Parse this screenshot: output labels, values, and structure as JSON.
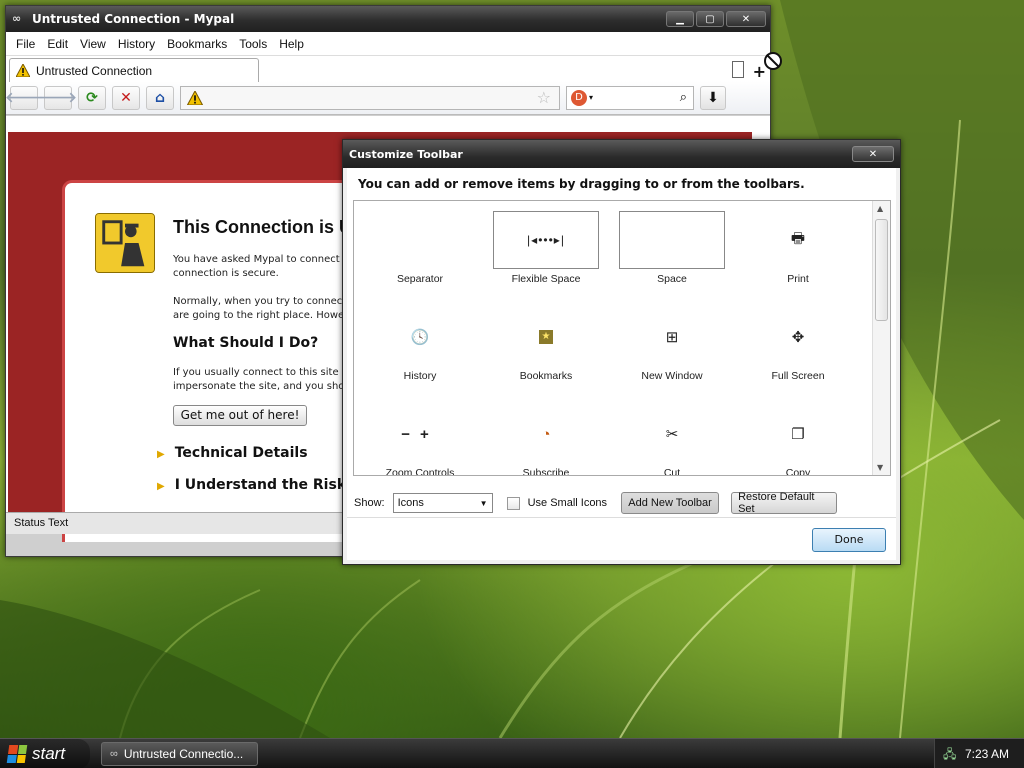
{
  "browser": {
    "title": "Untrusted Connection - Mypal",
    "menu": [
      "File",
      "Edit",
      "View",
      "History",
      "Bookmarks",
      "Tools",
      "Help"
    ],
    "tab_title": "Untrusted Connection",
    "new_tab": "+",
    "status_text": "Status Text"
  },
  "error_page": {
    "title": "This Connection is U",
    "p1_line1": "You have asked Mypal to connect se",
    "p1_line2": "connection is secure.",
    "p2_line1": "Normally, when you try to connect s",
    "p2_line2": "are going to the right place. Howev",
    "heading": "What Should I Do?",
    "p3_line1": "If you usually connect to this site wi",
    "p3_line2": "impersonate the site, and you shoul",
    "button": "Get me out of here!",
    "expander1": "Technical Details",
    "expander2": "I Understand the Risks"
  },
  "dialog": {
    "title": "Customize Toolbar",
    "close": "✕",
    "instructions": "You can add or remove items by dragging to or from the toolbars.",
    "items": [
      {
        "label": "Separator",
        "icon": "separator-icon"
      },
      {
        "label": "Flexible Space",
        "icon": "flexible-space-icon"
      },
      {
        "label": "Space",
        "icon": "space-icon"
      },
      {
        "label": "Print",
        "icon": "print-icon"
      },
      {
        "label": "History",
        "icon": "history-icon"
      },
      {
        "label": "Bookmarks",
        "icon": "bookmarks-icon"
      },
      {
        "label": "New Window",
        "icon": "new-window-icon"
      },
      {
        "label": "Full Screen",
        "icon": "full-screen-icon"
      },
      {
        "label": "Zoom Controls",
        "icon": "zoom-controls-icon"
      },
      {
        "label": "Subscribe",
        "icon": "subscribe-icon"
      },
      {
        "label": "Cut",
        "icon": "cut-icon"
      },
      {
        "label": "Copy",
        "icon": "copy-icon"
      }
    ],
    "show_label": "Show:",
    "show_value": "Icons",
    "small_icons_label": "Use Small Icons",
    "small_icons_checked": false,
    "add_toolbar": "Add New Toolbar",
    "restore_default": "Restore Default Set",
    "done": "Done"
  },
  "taskbar": {
    "start": "start",
    "task": "Untrusted Connectio...",
    "clock": "7:23 AM"
  },
  "colors": {
    "error_red": "#9b2424",
    "done_blue": "#b9dbf4"
  }
}
